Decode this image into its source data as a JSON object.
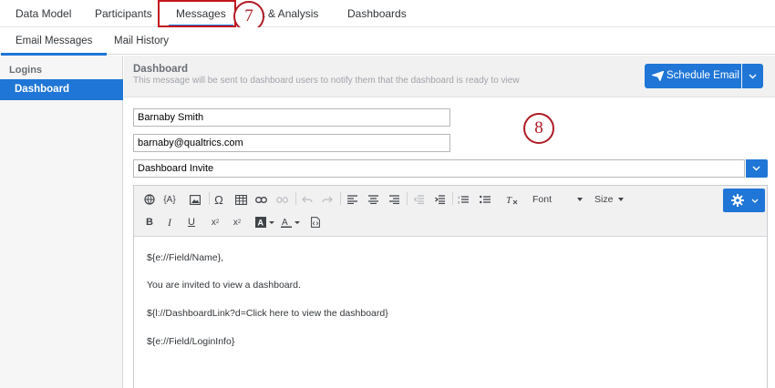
{
  "topnav": {
    "tabs": [
      {
        "label": "Data Model"
      },
      {
        "label": "Participants"
      },
      {
        "label": "Messages"
      },
      {
        "label": "a & Analysis"
      },
      {
        "label": "Dashboards"
      }
    ],
    "step_badge": "7"
  },
  "subnav": {
    "tabs": [
      {
        "label": "Email Messages"
      },
      {
        "label": "Mail History"
      }
    ]
  },
  "sidebar": {
    "heading": "Logins",
    "items": [
      {
        "label": "Dashboard"
      }
    ]
  },
  "message": {
    "title": "Dashboard",
    "subtitle": "This message will be sent to dashboard users to notify them that the dashboard is ready to view",
    "schedule_label": "Schedule Email",
    "step_badge": "8",
    "from_name": "Barnaby Smith",
    "from_email": "barnaby@qualtrics.com",
    "template": "Dashboard Invite"
  },
  "toolbar": {
    "font_label": "Font",
    "size_label": "Size"
  },
  "body": {
    "lines": [
      "${e://Field/Name},",
      "You are invited to view a dashboard.",
      "${l://DashboardLink?d=Click here to view the dashboard}",
      "${e://Field/LoginInfo}"
    ]
  },
  "colors": {
    "accent": "#1f76d6",
    "annotation": "#b01a24"
  }
}
